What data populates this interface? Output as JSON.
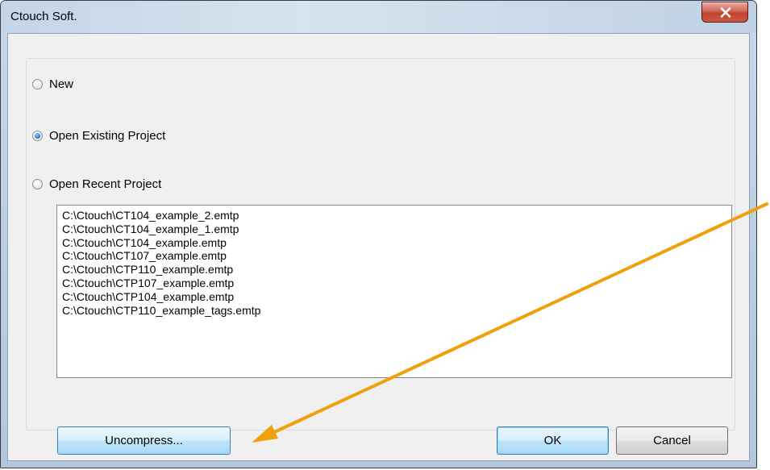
{
  "window": {
    "title": "Ctouch Soft.",
    "close_icon": "close-icon"
  },
  "options": {
    "new_label": "New",
    "open_existing_label": "Open Existing Project",
    "open_recent_label": "Open Recent Project",
    "selected": "open_existing"
  },
  "recent_projects": [
    "C:\\Ctouch\\CT104_example_2.emtp",
    "C:\\Ctouch\\CT104_example_1.emtp",
    "C:\\Ctouch\\CT104_example.emtp",
    "C:\\Ctouch\\CT107_example.emtp",
    "C:\\Ctouch\\CTP110_example.emtp",
    "C:\\Ctouch\\CTP107_example.emtp",
    "C:\\Ctouch\\CTP104_example.emtp",
    "C:\\Ctouch\\CTP110_example_tags.emtp"
  ],
  "buttons": {
    "uncompress_label": "Uncompress...",
    "ok_label": "OK",
    "cancel_label": "Cancel"
  },
  "colors": {
    "annotation_arrow": "#f0a00a",
    "close_button": "#c7432f"
  }
}
